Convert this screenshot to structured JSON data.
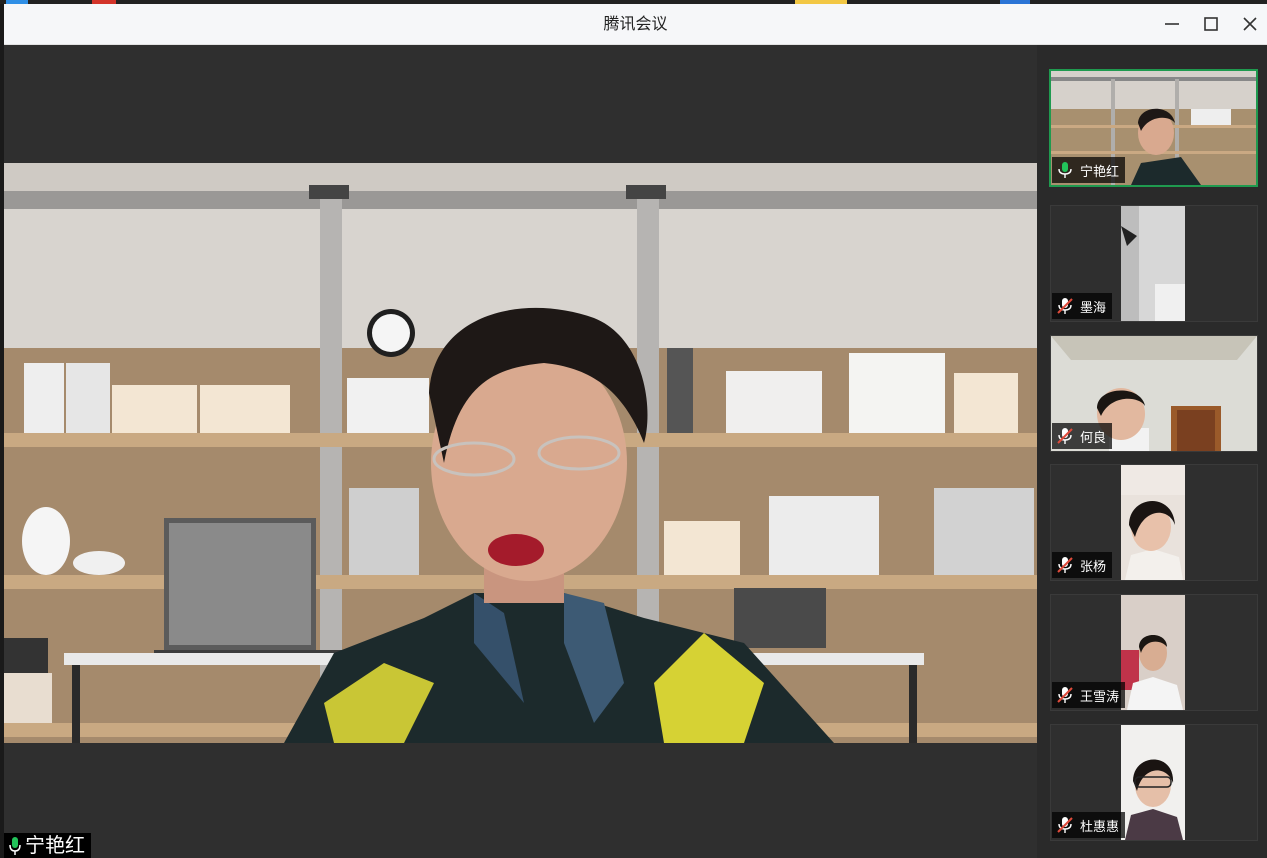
{
  "window": {
    "title": "腾讯会议"
  },
  "window_controls": [
    {
      "name": "minimize-button",
      "icon": "minimize-icon"
    },
    {
      "name": "maximize-button",
      "icon": "maximize-icon"
    },
    {
      "name": "close-button",
      "icon": "close-icon"
    }
  ],
  "main_speaker": {
    "name": "宁艳红",
    "mic_state": "on",
    "mic_icon": "microphone-on-icon"
  },
  "participants": [
    {
      "name": "宁艳红",
      "mic_state": "on",
      "active": true
    },
    {
      "name": "墨海",
      "mic_state": "muted"
    },
    {
      "name": "何良",
      "mic_state": "muted"
    },
    {
      "name": "张杨",
      "mic_state": "muted"
    },
    {
      "name": "王雪涛",
      "mic_state": "muted"
    },
    {
      "name": "杜惠惠",
      "mic_state": "muted"
    }
  ],
  "colors": {
    "active_border": "#1f9a4f",
    "mic_on": "#22c35a",
    "mic_muted": "#e14b3b",
    "stage_bg": "#2f2f2f",
    "titlebar_bg": "#f6f7f9"
  }
}
